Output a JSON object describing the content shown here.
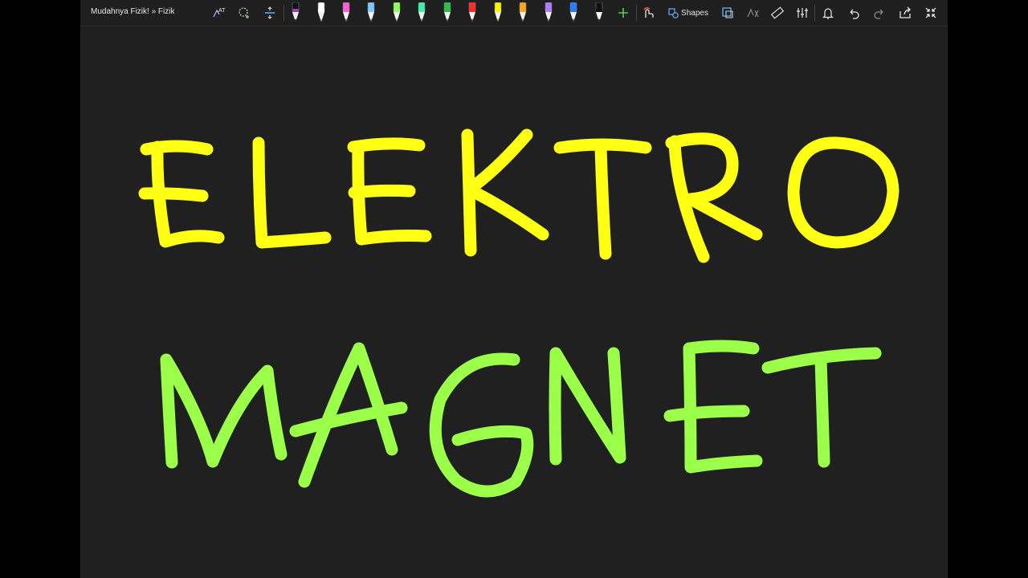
{
  "breadcrumb": {
    "text": "Mudahnya Fizik! » Fizik"
  },
  "toolbar": {
    "shapes_label": "Shapes",
    "pens": [
      {
        "name": "pen-black",
        "color": "#111111",
        "accent": "#9b3fc2"
      },
      {
        "name": "pen-white",
        "color": "#ffffff"
      },
      {
        "name": "pen-pink",
        "color": "#ff5fd2"
      },
      {
        "name": "pen-lightblue",
        "color": "#7cc8ff"
      },
      {
        "name": "pen-lightgreen",
        "color": "#8fff5a"
      },
      {
        "name": "pen-mint",
        "color": "#3ff0a8"
      },
      {
        "name": "pen-green",
        "color": "#26c04a"
      },
      {
        "name": "pen-red",
        "color": "#ff2a2a"
      },
      {
        "name": "pen-yellow",
        "color": "#fff200"
      },
      {
        "name": "pen-orange",
        "color": "#ffa21f"
      },
      {
        "name": "pen-purple",
        "color": "#b07bff"
      },
      {
        "name": "pen-blue",
        "color": "#2a7bff"
      },
      {
        "name": "pen-black-2",
        "color": "#111111"
      }
    ]
  },
  "canvas": {
    "ink_colors": {
      "yellow": "#ffff14",
      "green": "#9bff4a"
    },
    "background": "#202020"
  }
}
